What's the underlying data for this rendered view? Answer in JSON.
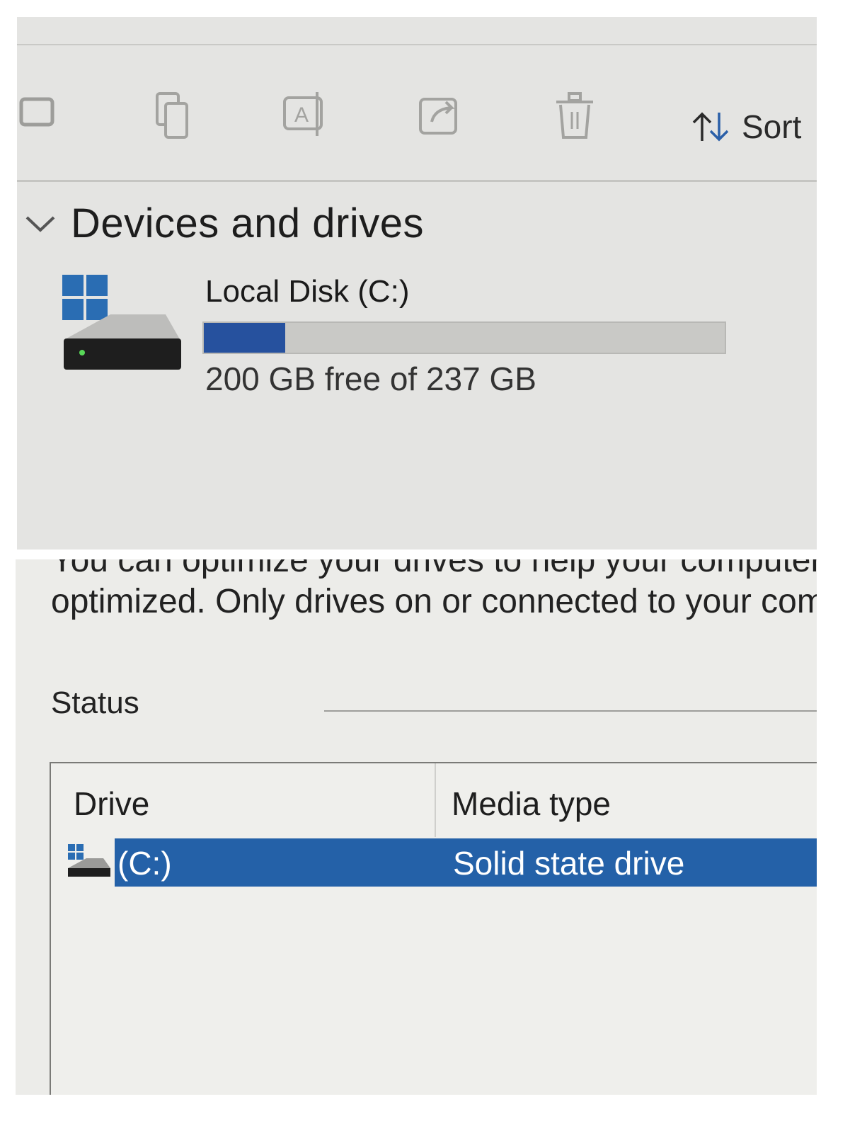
{
  "explorer": {
    "toolbar": {
      "icons": [
        "new-item-icon",
        "copy-icon",
        "rename-icon",
        "share-icon",
        "delete-icon"
      ],
      "sort_label": "Sort"
    },
    "devices_section": {
      "title": "Devices and drives",
      "drive": {
        "name": "Local Disk (C:)",
        "free_text": "200 GB free of 237 GB",
        "used_fraction": 0.156
      }
    }
  },
  "optimize": {
    "intro_line1": "You can optimize your drives to help your computer",
    "intro_line2": "optimized. Only drives on or connected to your com",
    "status_label": "Status",
    "table": {
      "columns": [
        "Drive",
        "Media type"
      ],
      "rows": [
        {
          "drive": "(C:)",
          "media_type": "Solid state drive"
        }
      ]
    }
  },
  "colors": {
    "accent": "#26519e",
    "selection": "#2461a8",
    "windows_logo": "#2a6db3"
  }
}
